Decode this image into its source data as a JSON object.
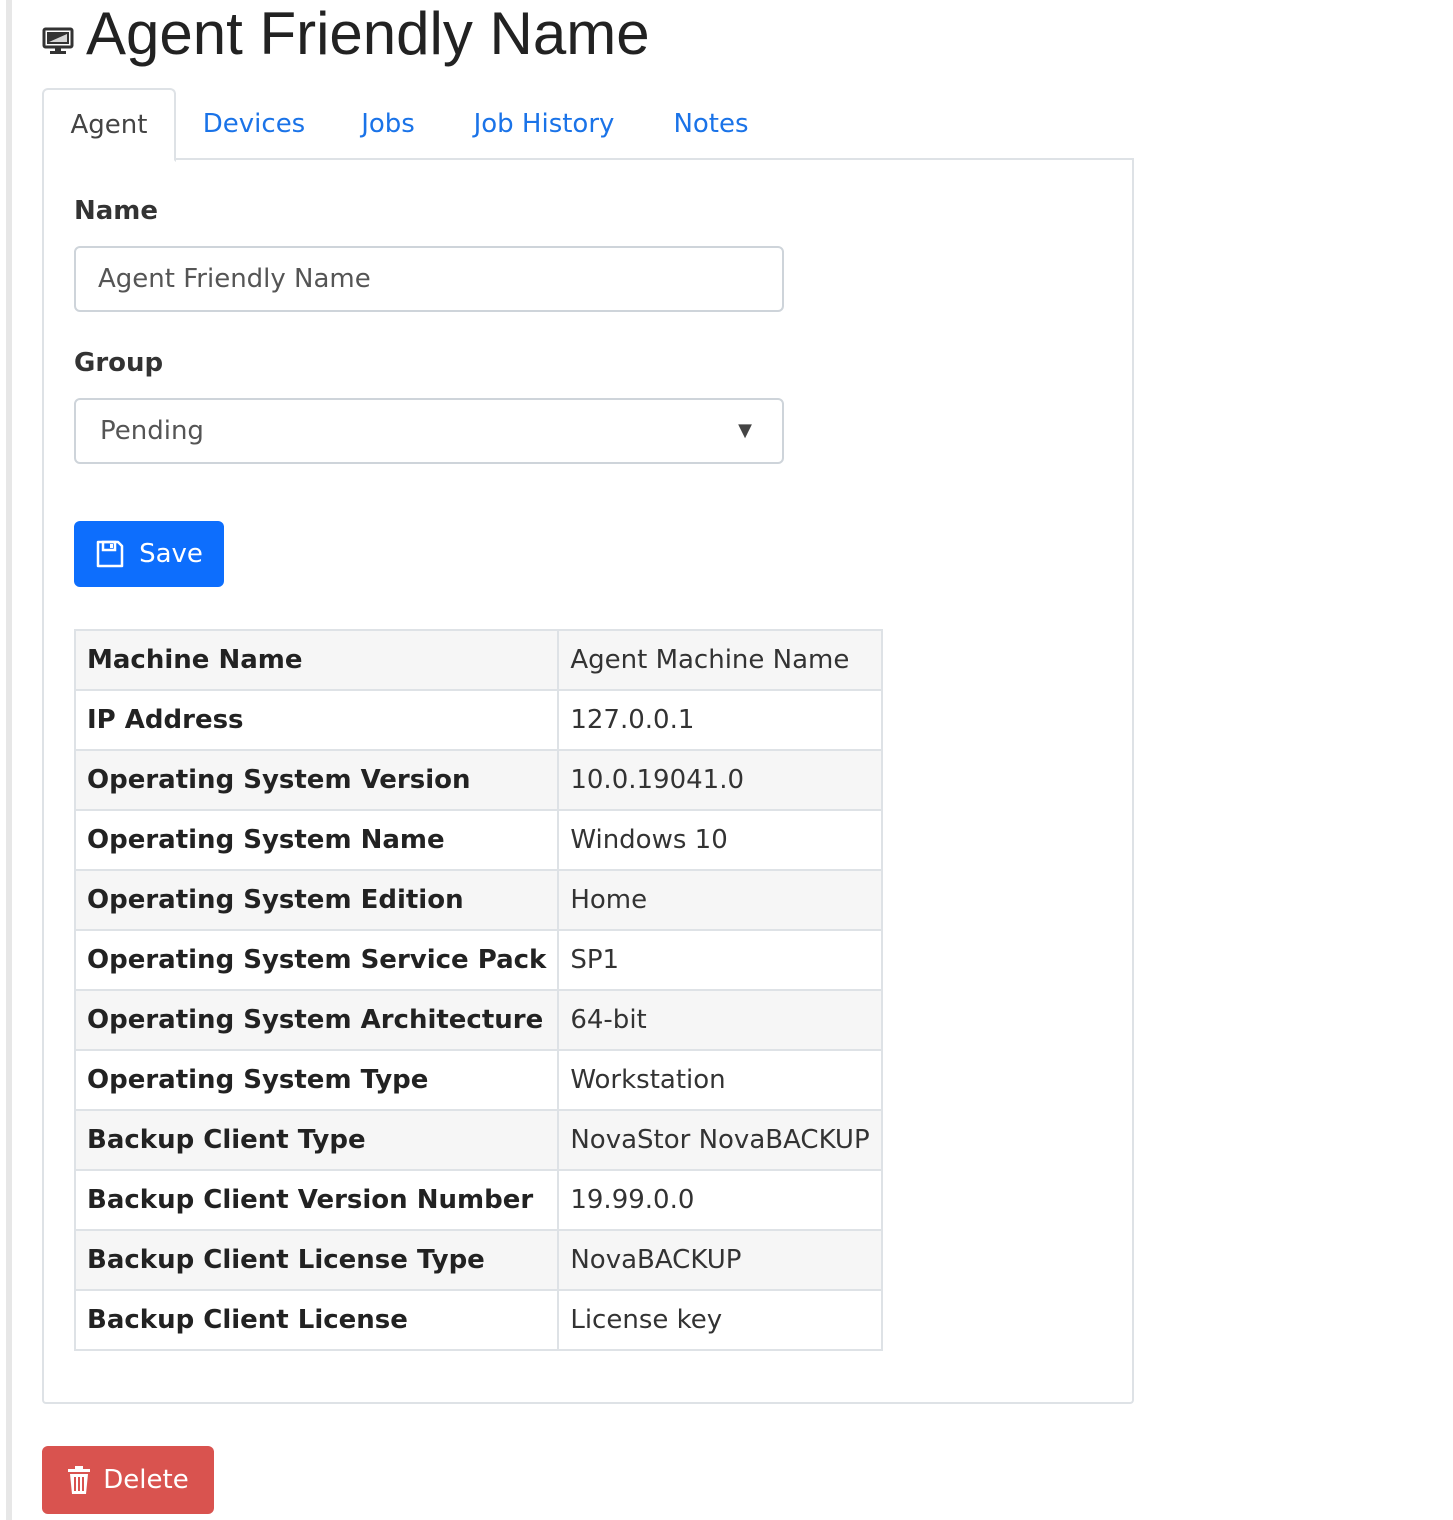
{
  "header": {
    "title": "Agent Friendly Name",
    "icon": "monitor-icon"
  },
  "tabs": [
    {
      "label": "Agent",
      "active": true
    },
    {
      "label": "Devices",
      "active": false
    },
    {
      "label": "Jobs",
      "active": false
    },
    {
      "label": "Job History",
      "active": false
    },
    {
      "label": "Notes",
      "active": false
    }
  ],
  "form": {
    "name_label": "Name",
    "name_value": "Agent Friendly Name",
    "group_label": "Group",
    "group_value": "Pending",
    "save_label": "Save"
  },
  "details": [
    {
      "key": "Machine Name",
      "value": "Agent Machine Name"
    },
    {
      "key": "IP Address",
      "value": "127.0.0.1"
    },
    {
      "key": "Operating System Version",
      "value": "10.0.19041.0"
    },
    {
      "key": "Operating System Name",
      "value": "Windows 10"
    },
    {
      "key": "Operating System Edition",
      "value": "Home"
    },
    {
      "key": "Operating System Service Pack",
      "value": "SP1"
    },
    {
      "key": "Operating System Architecture",
      "value": "64-bit"
    },
    {
      "key": "Operating System Type",
      "value": "Workstation"
    },
    {
      "key": "Backup Client Type",
      "value": "NovaStor NovaBACKUP"
    },
    {
      "key": "Backup Client Version Number",
      "value": "19.99.0.0"
    },
    {
      "key": "Backup Client License Type",
      "value": "NovaBACKUP"
    },
    {
      "key": "Backup Client License",
      "value": "License key"
    }
  ],
  "actions": {
    "delete_label": "Delete"
  },
  "colors": {
    "link": "#1a73e8",
    "primary": "#0d6efd",
    "danger": "#d9534f"
  }
}
